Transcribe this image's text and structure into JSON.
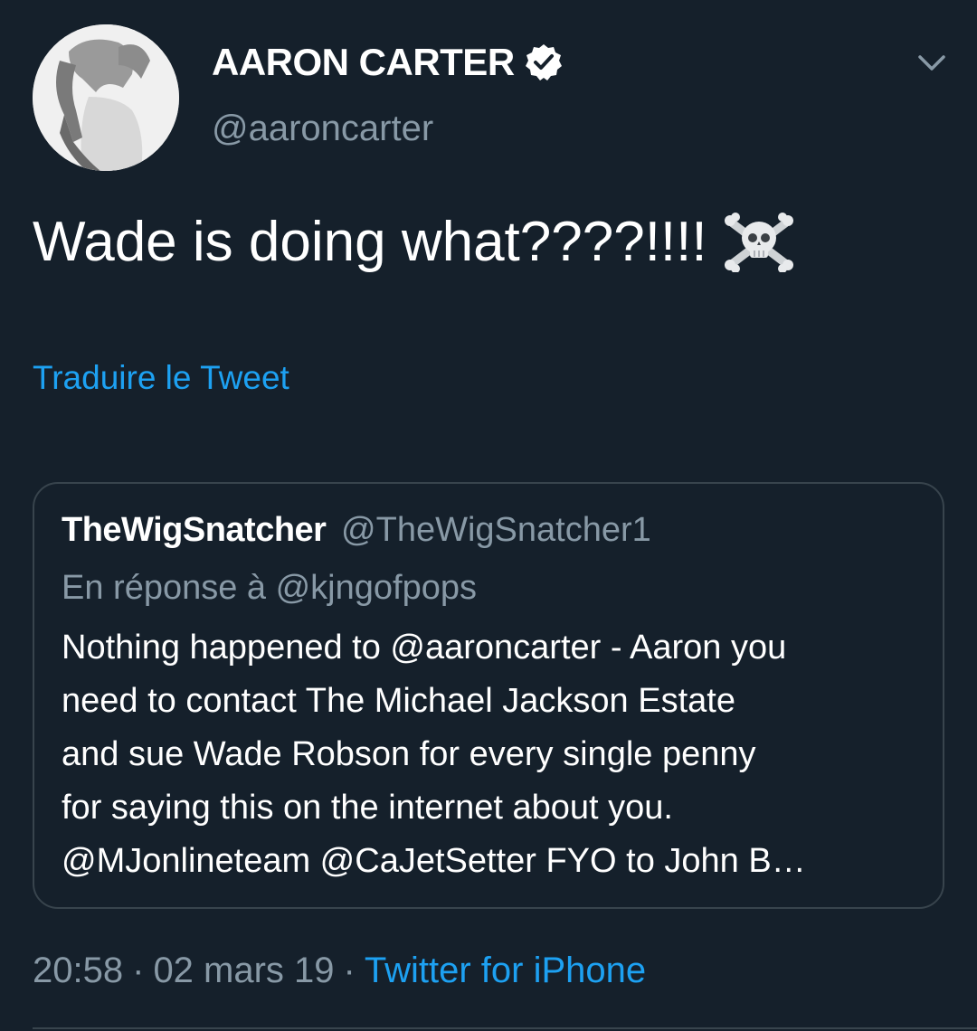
{
  "tweet": {
    "display_name": "AARON CARTER",
    "handle": "@aaroncarter",
    "text": "Wade is doing what????!!!!",
    "emoji": "skull-and-crossbones",
    "translate_label": "Traduire le Tweet",
    "time": "20:58",
    "date": "02 mars 19",
    "separator": "·",
    "source": "Twitter for iPhone"
  },
  "quoted_tweet": {
    "display_name": "TheWigSnatcher",
    "handle": "@TheWigSnatcher1",
    "reply_to": "En réponse à @kjngofpops",
    "lines": [
      "Nothing happened to @aaroncarter - Aaron you",
      "need to contact The Michael Jackson Estate",
      "and sue Wade Robson for every single penny",
      "for saying this on the internet about you.",
      "@MJonlineteam @CaJetSetter FYO to John B…"
    ]
  },
  "icons": {
    "verified": "verified-badge-icon",
    "menu": "chevron-down-icon",
    "skull": "skull-crossbones-icon"
  },
  "colors": {
    "background": "#15202b",
    "link": "#1da1f2",
    "secondary_text": "#8899a6",
    "border": "#38444d"
  }
}
